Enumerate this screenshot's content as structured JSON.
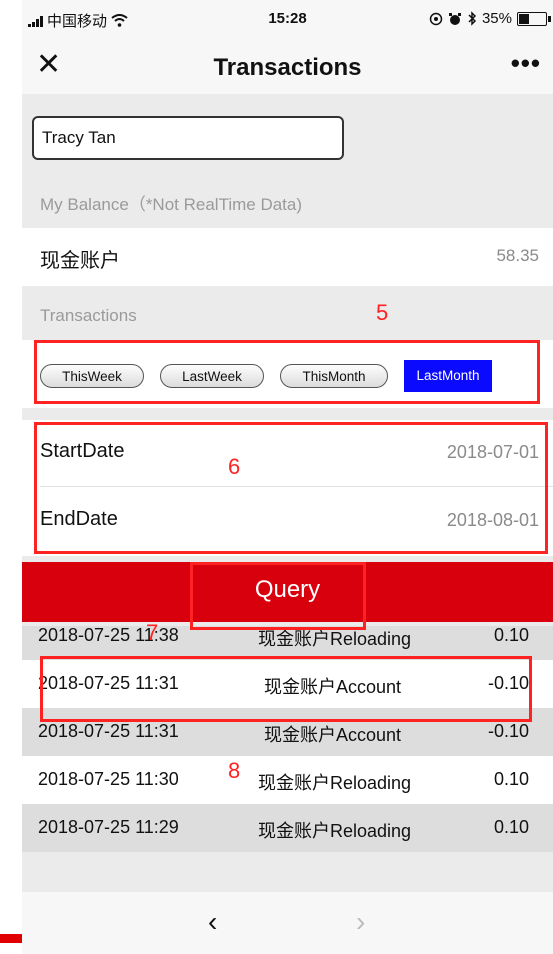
{
  "status_bar": {
    "carrier": "中国移动",
    "time": "15:28",
    "battery": "35%",
    "battery_level": 0.35
  },
  "nav": {
    "title": "Transactions",
    "close_icon": "close-icon",
    "more_icon": "more-icon"
  },
  "user": {
    "name": "Tracy Tan"
  },
  "balance": {
    "section_label": "My Balance（*Not RealTime Data)",
    "account_name": "现金账户",
    "amount": "58.35"
  },
  "transactions": {
    "section_label": "Transactions",
    "filters": [
      "ThisWeek",
      "LastWeek",
      "ThisMonth",
      "LastMonth"
    ],
    "active_filter": "LastMonth",
    "start_label": "StartDate",
    "start_value": "2018-07-01",
    "end_label": "EndDate",
    "end_value": "2018-08-01",
    "query_label": "Query",
    "rows": [
      {
        "time": "2018-07-25 11:38",
        "desc": "现金账户Reloading",
        "amount": "0.10"
      },
      {
        "time": "2018-07-25 11:31",
        "desc": "现金账户Account",
        "amount": "-0.10"
      },
      {
        "time": "2018-07-25 11:31",
        "desc": "现金账户Account",
        "amount": "-0.10"
      },
      {
        "time": "2018-07-25 11:30",
        "desc": "现金账户Reloading",
        "amount": "0.10"
      },
      {
        "time": "2018-07-25 11:29",
        "desc": "现金账户Reloading",
        "amount": "0.10"
      }
    ]
  },
  "toolbar": {
    "back_symbol": "‹",
    "forward_symbol": "›"
  },
  "annotations": {
    "n5": "5",
    "n6": "6",
    "n7": "7",
    "n8": "8"
  },
  "colors": {
    "query_bar": "#d9000e",
    "active_filter": "#0a0aff",
    "annotation": "#ff2222"
  }
}
